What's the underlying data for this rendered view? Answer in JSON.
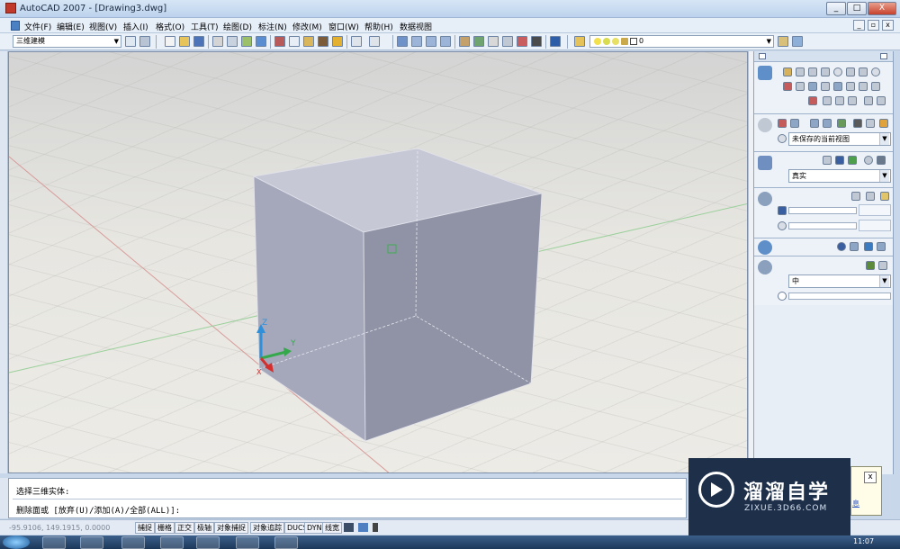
{
  "window": {
    "title": "AutoCAD 2007 - [Drawing3.dwg]",
    "minimize": "_",
    "maximize": "□",
    "close": "X"
  },
  "menu": {
    "items": [
      "文件(F)",
      "编辑(E)",
      "视图(V)",
      "插入(I)",
      "格式(O)",
      "工具(T)",
      "绘图(D)",
      "标注(N)",
      "修改(M)",
      "窗口(W)",
      "帮助(H)",
      "数据视图"
    ],
    "doc_min": "_",
    "doc_restore": "▫",
    "doc_close": "x"
  },
  "toolbar": {
    "workspace": "三维建模",
    "layer_value": "0"
  },
  "viewport": {
    "axis_x": "X",
    "axis_y": "Y",
    "axis_z": "Z"
  },
  "palette": {
    "named_view": "未保存的当前视图",
    "visual_style": "真实",
    "material_quality": "中"
  },
  "command": {
    "line1": "选择三维实体:",
    "line2": "删除面或 [放弃(U)/添加(A)/全部(ALL)]:"
  },
  "status": {
    "coords": "-95.9106, 149.1915, 0.0000",
    "buttons": [
      "捕捉",
      "栅格",
      "正交",
      "极轴",
      "对象捕捉",
      "对象追踪",
      "DUCS",
      "DYN",
      "线宽"
    ]
  },
  "watermark": {
    "title": "溜溜自学",
    "subtitle": "ZIXUE.3D66.COM"
  },
  "notify": {
    "close": "x",
    "text": "息"
  },
  "taskbar": {
    "clock": "11:07"
  }
}
